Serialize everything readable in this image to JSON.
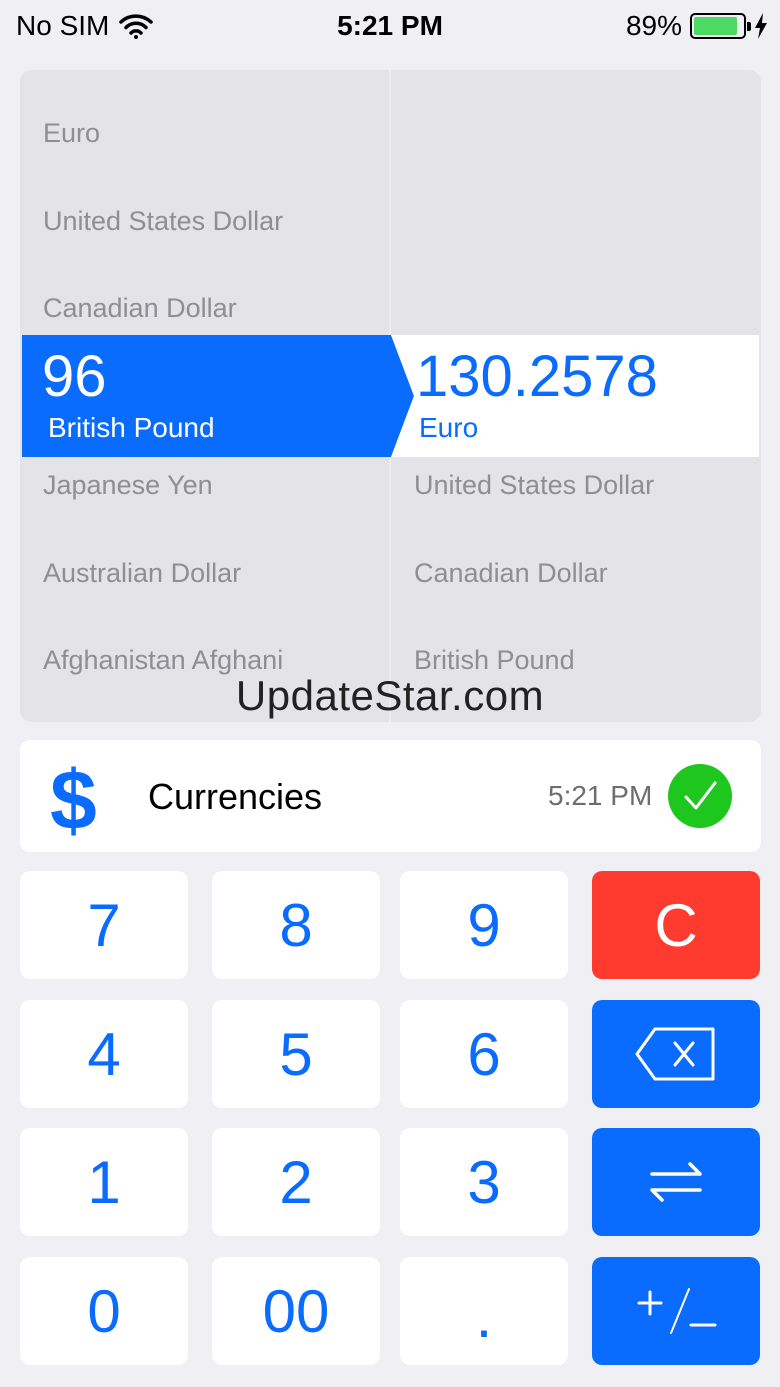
{
  "status_bar": {
    "carrier": "No SIM",
    "time": "5:21 PM",
    "battery": "89%",
    "battery_level": 0.89
  },
  "picker": {
    "left_above": [
      "Euro",
      "United States Dollar",
      "Canadian Dollar"
    ],
    "left_below": [
      "Japanese Yen",
      "Australian Dollar",
      "Afghanistan Afghani"
    ],
    "right_below": [
      "United States Dollar",
      "Canadian Dollar",
      "British Pound"
    ],
    "selected_left": {
      "value": "96",
      "name": "British Pound"
    },
    "selected_right": {
      "value": "130.2578",
      "name": "Euro"
    }
  },
  "watermark": "UpdateStar.com",
  "info": {
    "icon": "dollar-icon",
    "title": "Currencies",
    "time": "5:21 PM",
    "status_icon": "check-icon"
  },
  "keypad": {
    "k7": "7",
    "k8": "8",
    "k9": "9",
    "clear": "C",
    "k4": "4",
    "k5": "5",
    "k6": "6",
    "k1": "1",
    "k2": "2",
    "k3": "3",
    "k0": "0",
    "k00": "00",
    "dot": "."
  },
  "colors": {
    "accent": "#0a6cff",
    "clear": "#ff3b30",
    "success": "#1ec71e",
    "battery": "#4cd964"
  }
}
